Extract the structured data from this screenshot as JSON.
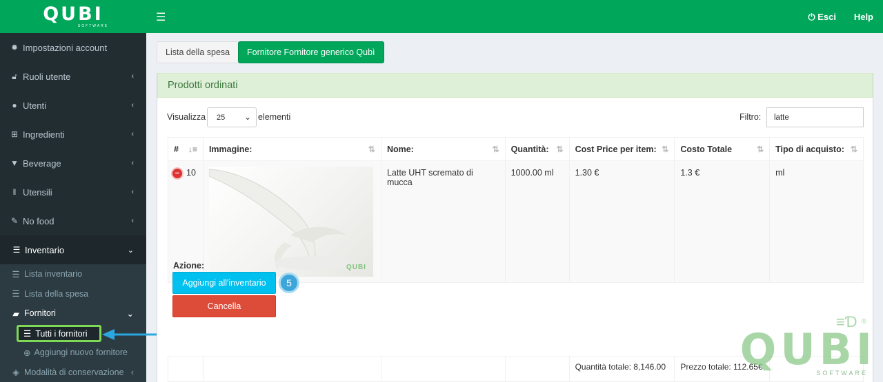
{
  "brand": {
    "logo": "QUBI",
    "sub": "SOFTWARE",
    "accent": "#00a65a"
  },
  "topbar": {
    "esci": "Esci",
    "help": "Help"
  },
  "sidebar": {
    "items": [
      {
        "label": "Impostazioni account",
        "icon": "gear-icon"
      },
      {
        "label": "Ruoli utente",
        "icon": "unlock-icon"
      },
      {
        "label": "Utenti",
        "icon": "user-icon"
      },
      {
        "label": "Ingredienti",
        "icon": "sitemap-icon"
      },
      {
        "label": "Beverage",
        "icon": "filter-icon"
      },
      {
        "label": "Utensili",
        "icon": "cutlery-icon"
      },
      {
        "label": "No food",
        "icon": "wrench-icon"
      },
      {
        "label": "Inventario",
        "icon": "table-icon"
      }
    ],
    "sub": {
      "lista_inventario": "Lista inventario",
      "lista_spesa": "Lista della spesa",
      "fornitori": "Fornitori",
      "tutti_fornitori": "Tutti i fornitori",
      "aggiungi_fornitore": "Aggiungi nuovo fornitore",
      "modalita": "Modalità di conservazione"
    }
  },
  "tabs": {
    "lista": "Lista della spesa",
    "fornitore": "Fornitore Fornitore generico Qubì"
  },
  "box": {
    "title": "Prodotti ordinati"
  },
  "controls": {
    "visualizza": "Visualizza",
    "page_size": "25",
    "elementi": "elementi",
    "filtro": "Filtro:",
    "filter_value": "latte"
  },
  "table": {
    "headers": [
      "#",
      "Immagine:",
      "Nome:",
      "Quantità:",
      "Cost Price per item:",
      "Costo Totale",
      "Tipo di acquisto:"
    ],
    "row": {
      "id": "10",
      "nome": "Latte UHT scremato di mucca",
      "quantita": "1000.00 ml",
      "cost_price": "1.30 €",
      "costo_totale": "1.3 €",
      "tipo": "ml",
      "img_logo": "QUBI"
    },
    "totals": {
      "quantita": "Quantità totale: 8,146.00",
      "prezzo": "Prezzo totale: 112.65€"
    }
  },
  "actions": {
    "azione": "Azione:",
    "add": "Aggiungi all'inventario",
    "cancel": "Cancella",
    "step": "5"
  },
  "watermark": {
    "word": "QUBI",
    "sub": "SOFTWARE",
    "reg": "®"
  }
}
